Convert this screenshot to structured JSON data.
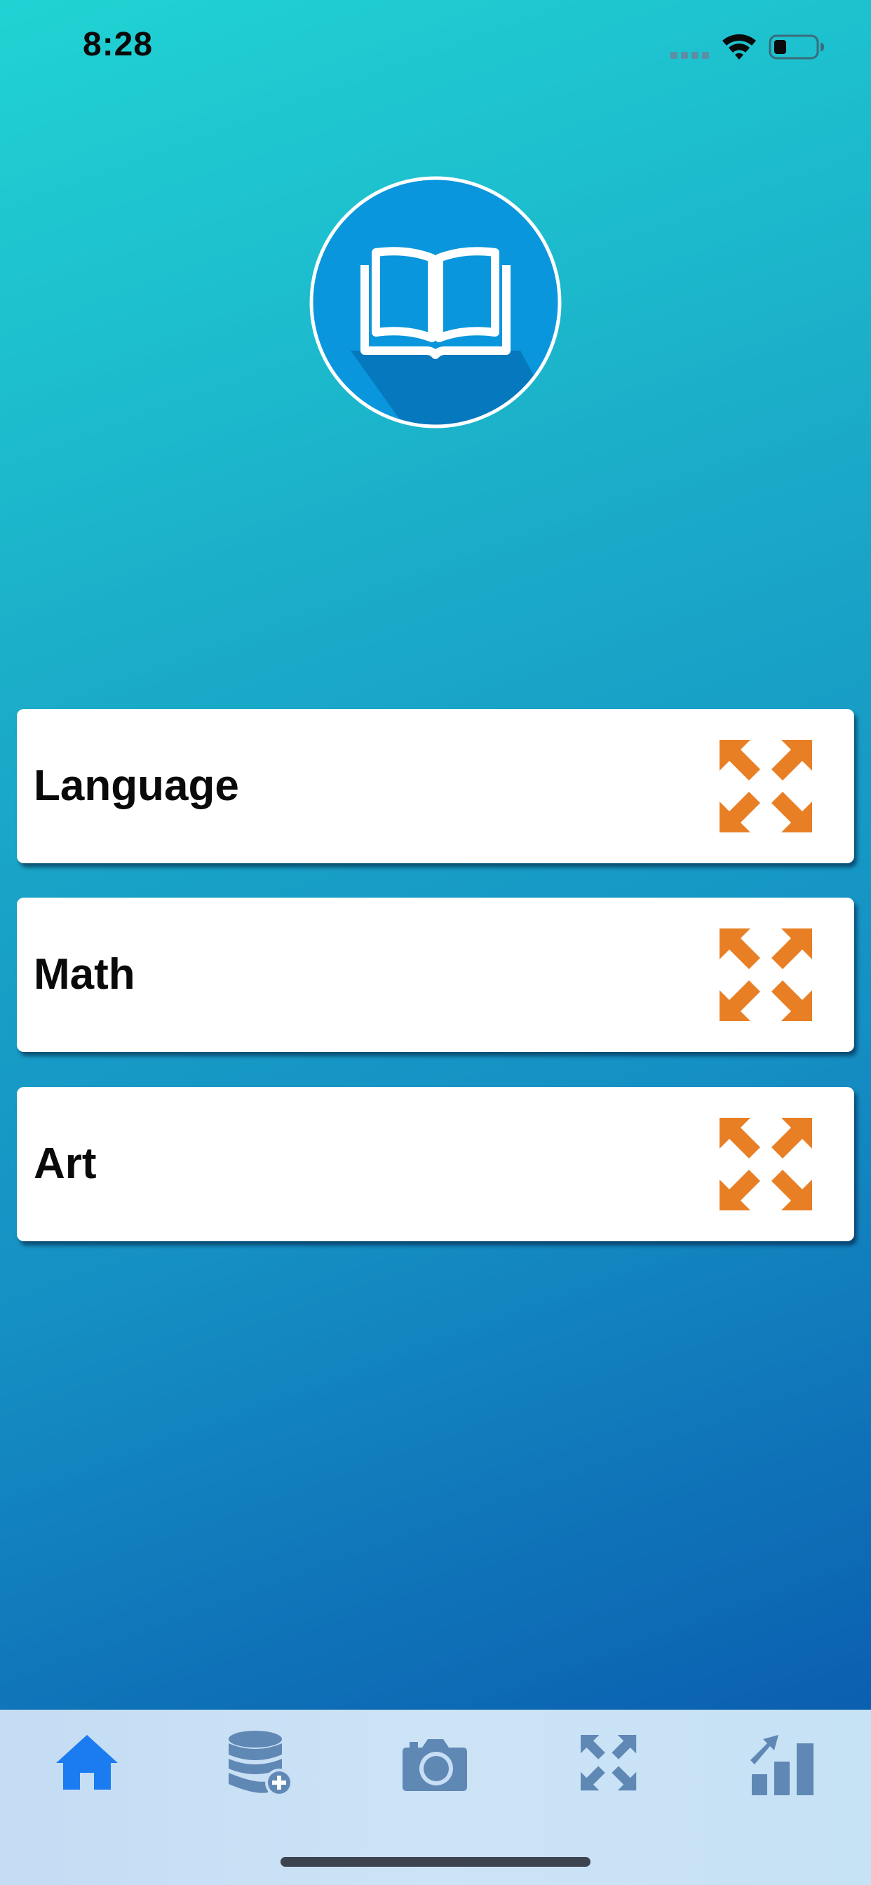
{
  "status_bar": {
    "time": "8:28",
    "icons": [
      "signal-icon",
      "wifi-icon",
      "battery-icon"
    ]
  },
  "logo": {
    "icon": "open-book-icon",
    "colors": {
      "circle": "#0a96dc",
      "shadow": "#0678bd",
      "stroke": "#ffffff"
    }
  },
  "subjects": [
    {
      "label": "Language",
      "icon": "expand-arrows-icon"
    },
    {
      "label": "Math",
      "icon": "expand-arrows-icon"
    },
    {
      "label": "Art",
      "icon": "expand-arrows-icon"
    }
  ],
  "tab_bar": {
    "items": [
      {
        "icon": "home-icon",
        "active": true
      },
      {
        "icon": "database-add-icon",
        "active": false
      },
      {
        "icon": "camera-icon",
        "active": false
      },
      {
        "icon": "expand-arrows-icon",
        "active": false
      },
      {
        "icon": "bar-chart-growth-icon",
        "active": false
      }
    ],
    "colors": {
      "active": "#1a7cf0",
      "inactive": "#5f88b5"
    }
  },
  "colors": {
    "accent_orange": "#e87f25",
    "card_background": "#ffffff",
    "gradient_top": "#20d3d3",
    "gradient_bottom": "#0a58ad"
  }
}
